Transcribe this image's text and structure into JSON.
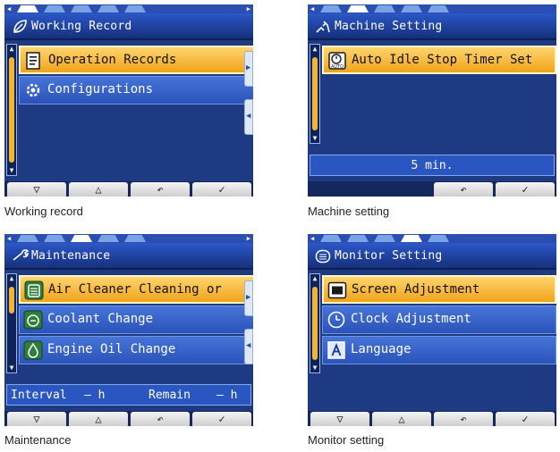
{
  "panels": [
    {
      "title": "Working Record",
      "title_icon": "leaf-icon",
      "caption": "Working record",
      "items": [
        {
          "label": "Operation Records",
          "icon": "document-icon",
          "selected": true
        },
        {
          "label": "Configurations",
          "icon": "gear-icon",
          "selected": false
        }
      ],
      "softkeys": [
        "▽",
        "△",
        "↶",
        "✓"
      ]
    },
    {
      "title": "Machine Setting",
      "title_icon": "machine-icon",
      "caption": "Machine setting",
      "items": [
        {
          "label": "Auto Idle Stop Timer Set",
          "icon": "auto-timer-icon",
          "selected": true
        }
      ],
      "value": "5 min.",
      "softkeys": [
        "↶",
        "✓"
      ]
    },
    {
      "title": "Maintenance",
      "title_icon": "wrench-icon",
      "caption": "Maintenance",
      "items": [
        {
          "label": "Air Cleaner Cleaning or",
          "icon": "air-cleaner-icon",
          "selected": true
        },
        {
          "label": "Coolant Change",
          "icon": "coolant-icon",
          "selected": false
        },
        {
          "label": "Engine Oil Change",
          "icon": "engine-oil-icon",
          "selected": false
        }
      ],
      "interval_label": "Interval",
      "interval_value": "— h",
      "remain_label": "Remain",
      "remain_value": "— h",
      "softkeys": [
        "▽",
        "△",
        "↶",
        "✓"
      ]
    },
    {
      "title": "Monitor Setting",
      "title_icon": "monitor-icon",
      "caption": "Monitor setting",
      "items": [
        {
          "label": "Screen Adjustment",
          "icon": "screen-icon",
          "selected": true
        },
        {
          "label": "Clock Adjustment",
          "icon": "clock-icon",
          "selected": false
        },
        {
          "label": "Language",
          "icon": "language-icon",
          "selected": false
        }
      ],
      "softkeys": [
        "▽",
        "△",
        "↶",
        "✓"
      ]
    }
  ],
  "colors": {
    "panel_bg": "#1d3a82",
    "selected_item": "#f6b832",
    "normal_item": "#3862c9",
    "title_bar": "#2150be"
  }
}
